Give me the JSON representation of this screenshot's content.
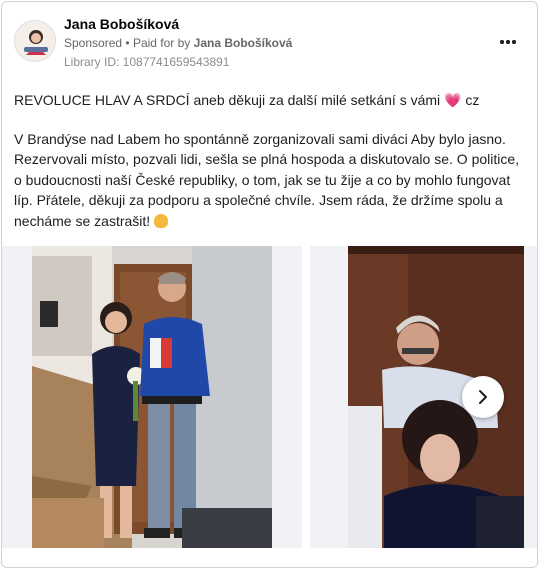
{
  "post": {
    "author_name": "Jana Bobošíková",
    "sponsored_label": "Sponsored",
    "separator": "•",
    "paid_for_label": "Paid for by",
    "paid_for_name": "Jana Bobošíková",
    "library_id": "Library ID: 1087741659543891",
    "more_icon": "more-horizontal-icon",
    "text_line_1": "REVOLUCE HLAV A SRDCÍ aneb děkuji za další milé setkání s vámi",
    "text_line_1_suffix": "cz",
    "heart_emoji": "💗",
    "text_paragraph_2": "V Brandýse nad Labem ho spontánně zorganizovali sami diváci Aby bylo jasno. Rezervovali místo, pozvali lidi, sešla se plná hospoda a diskutovalo se. O politice, o budoucnosti naší České republiky, o tom, jak se tu žije a co by mohlo fungovat líp. Přátele, děkuji za podporu a společné chvíle. Jsem ráda, že držíme spolu a necháme se zastrašit!",
    "flex_emoji": "flexed-biceps-emoji"
  },
  "carousel": {
    "next_icon": "chevron-right-icon",
    "slide_count_visible": 2
  },
  "colors": {
    "text": "#1c1e21",
    "secondary": "#65676b",
    "border": "#cfd2d6",
    "heart": "#e0245e"
  }
}
